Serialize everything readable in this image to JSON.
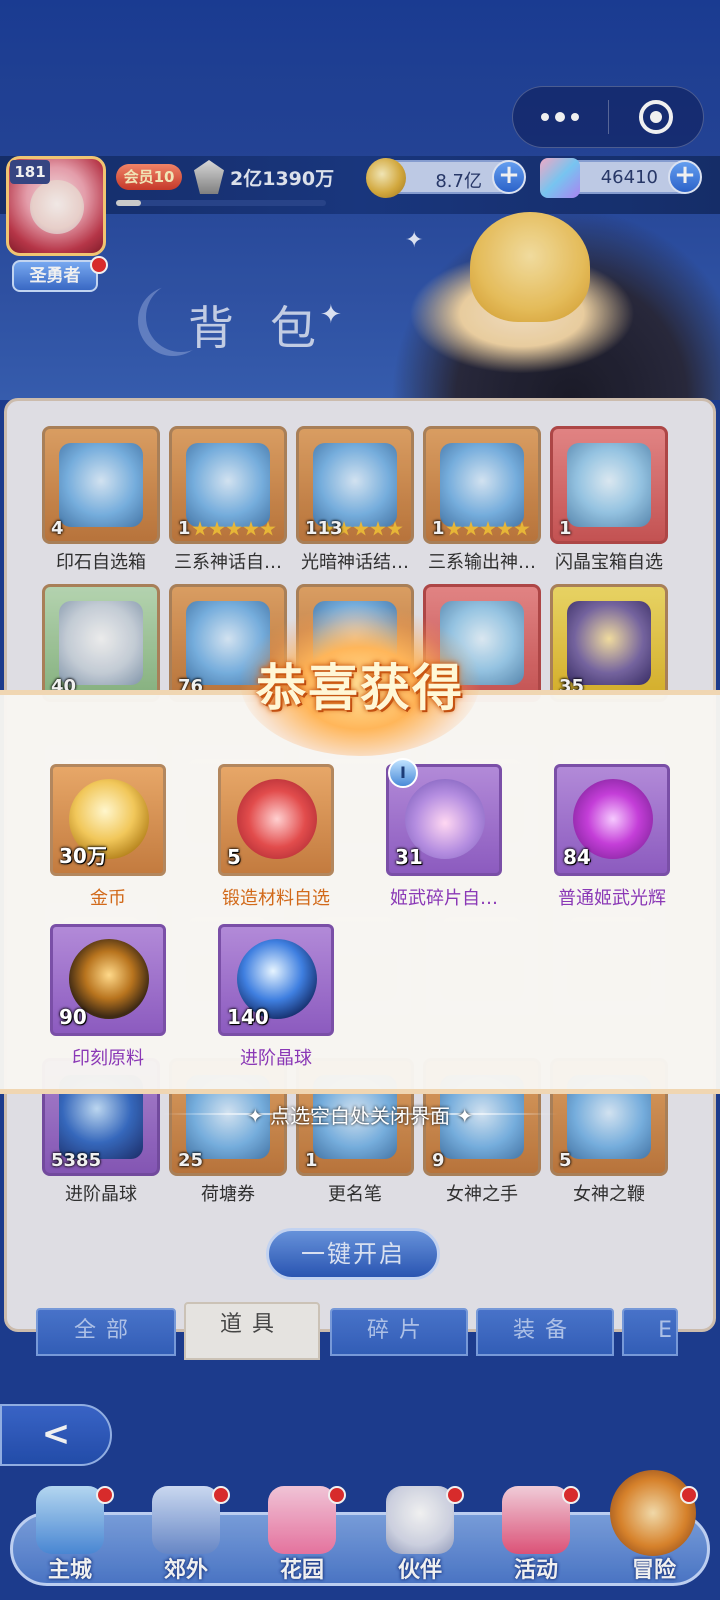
{
  "header": {
    "player_level": "181",
    "player_title": "圣勇者",
    "vip_label": "会员10",
    "power": "2亿1390万",
    "power_progress": 0.12,
    "gold": "8.7亿",
    "gems": "46410",
    "page_title": "背包"
  },
  "inventory": [
    {
      "label": "印石自选箱",
      "qty": "4",
      "bg": "orange"
    },
    {
      "label": "三系神话自…",
      "qty": "1",
      "bg": "orange",
      "stars": 5
    },
    {
      "label": "光暗神话结…",
      "qty": "113",
      "bg": "orange",
      "stars": 5
    },
    {
      "label": "三系输出神…",
      "qty": "1",
      "bg": "orange",
      "stars": 5
    },
    {
      "label": "闪晶宝箱自选",
      "qty": "1",
      "bg": "red"
    },
    {
      "label": "",
      "qty": "40",
      "bg": "green"
    },
    {
      "label": "",
      "qty": "76",
      "bg": "orange"
    },
    {
      "label": "",
      "qty": "",
      "bg": "orange"
    },
    {
      "label": "",
      "qty": "",
      "bg": "red"
    },
    {
      "label": "",
      "qty": "35",
      "bg": "yellow"
    },
    {
      "label": "",
      "qty": "",
      "bg": "gray"
    },
    {
      "label": "",
      "qty": "",
      "bg": "gray"
    },
    {
      "label": "",
      "qty": "",
      "bg": "gray"
    },
    {
      "label": "",
      "qty": "",
      "bg": "gray"
    },
    {
      "label": "",
      "qty": "",
      "bg": "gray"
    },
    {
      "label": "",
      "qty": "",
      "bg": "gray"
    },
    {
      "label": "",
      "qty": "",
      "bg": "gray"
    },
    {
      "label": "",
      "qty": "",
      "bg": "gray"
    },
    {
      "label": "",
      "qty": "",
      "bg": "gray"
    },
    {
      "label": "",
      "qty": "",
      "bg": "gray"
    },
    {
      "label": "进阶晶球",
      "qty": "5385",
      "bg": "purple"
    },
    {
      "label": "荷塘券",
      "qty": "25",
      "bg": "orange"
    },
    {
      "label": "更名笔",
      "qty": "1",
      "bg": "orange"
    },
    {
      "label": "女神之手",
      "qty": "9",
      "bg": "orange"
    },
    {
      "label": "女神之鞭",
      "qty": "5",
      "bg": "orange"
    }
  ],
  "open_all_button": "一键开启",
  "tabs": [
    "全部",
    "道具",
    "碎片",
    "装备",
    "E"
  ],
  "active_tab": 1,
  "back_button": "<",
  "nav": [
    {
      "label": "主城",
      "icon": "castle-icon"
    },
    {
      "label": "郊外",
      "icon": "gate-icon"
    },
    {
      "label": "花园",
      "icon": "heart-garden-icon"
    },
    {
      "label": "伙伴",
      "icon": "companion-icon"
    },
    {
      "label": "活动",
      "icon": "gift-icon"
    },
    {
      "label": "冒险",
      "icon": "adventure-icon"
    }
  ],
  "reward_popup": {
    "title": "恭喜获得",
    "items": [
      {
        "label": "金币",
        "qty": "30万",
        "rarity": "orange",
        "icon": "gold-coin-icon"
      },
      {
        "label": "锻造材料自选",
        "qty": "5",
        "rarity": "orange",
        "icon": "forge-chest-icon"
      },
      {
        "label": "姬武碎片自…",
        "qty": "31",
        "rarity": "purple",
        "icon": "weapon-shard-chest-icon",
        "badge": "I"
      },
      {
        "label": "普通姬武光辉",
        "qty": "84",
        "rarity": "purple",
        "icon": "purple-gem-icon"
      },
      {
        "label": "印刻原料",
        "qty": "90",
        "rarity": "purple",
        "icon": "engrave-material-icon"
      },
      {
        "label": "进阶晶球",
        "qty": "140",
        "rarity": "purple",
        "icon": "crystal-orb-icon"
      }
    ],
    "close_hint": "点选空白处关闭界面"
  }
}
